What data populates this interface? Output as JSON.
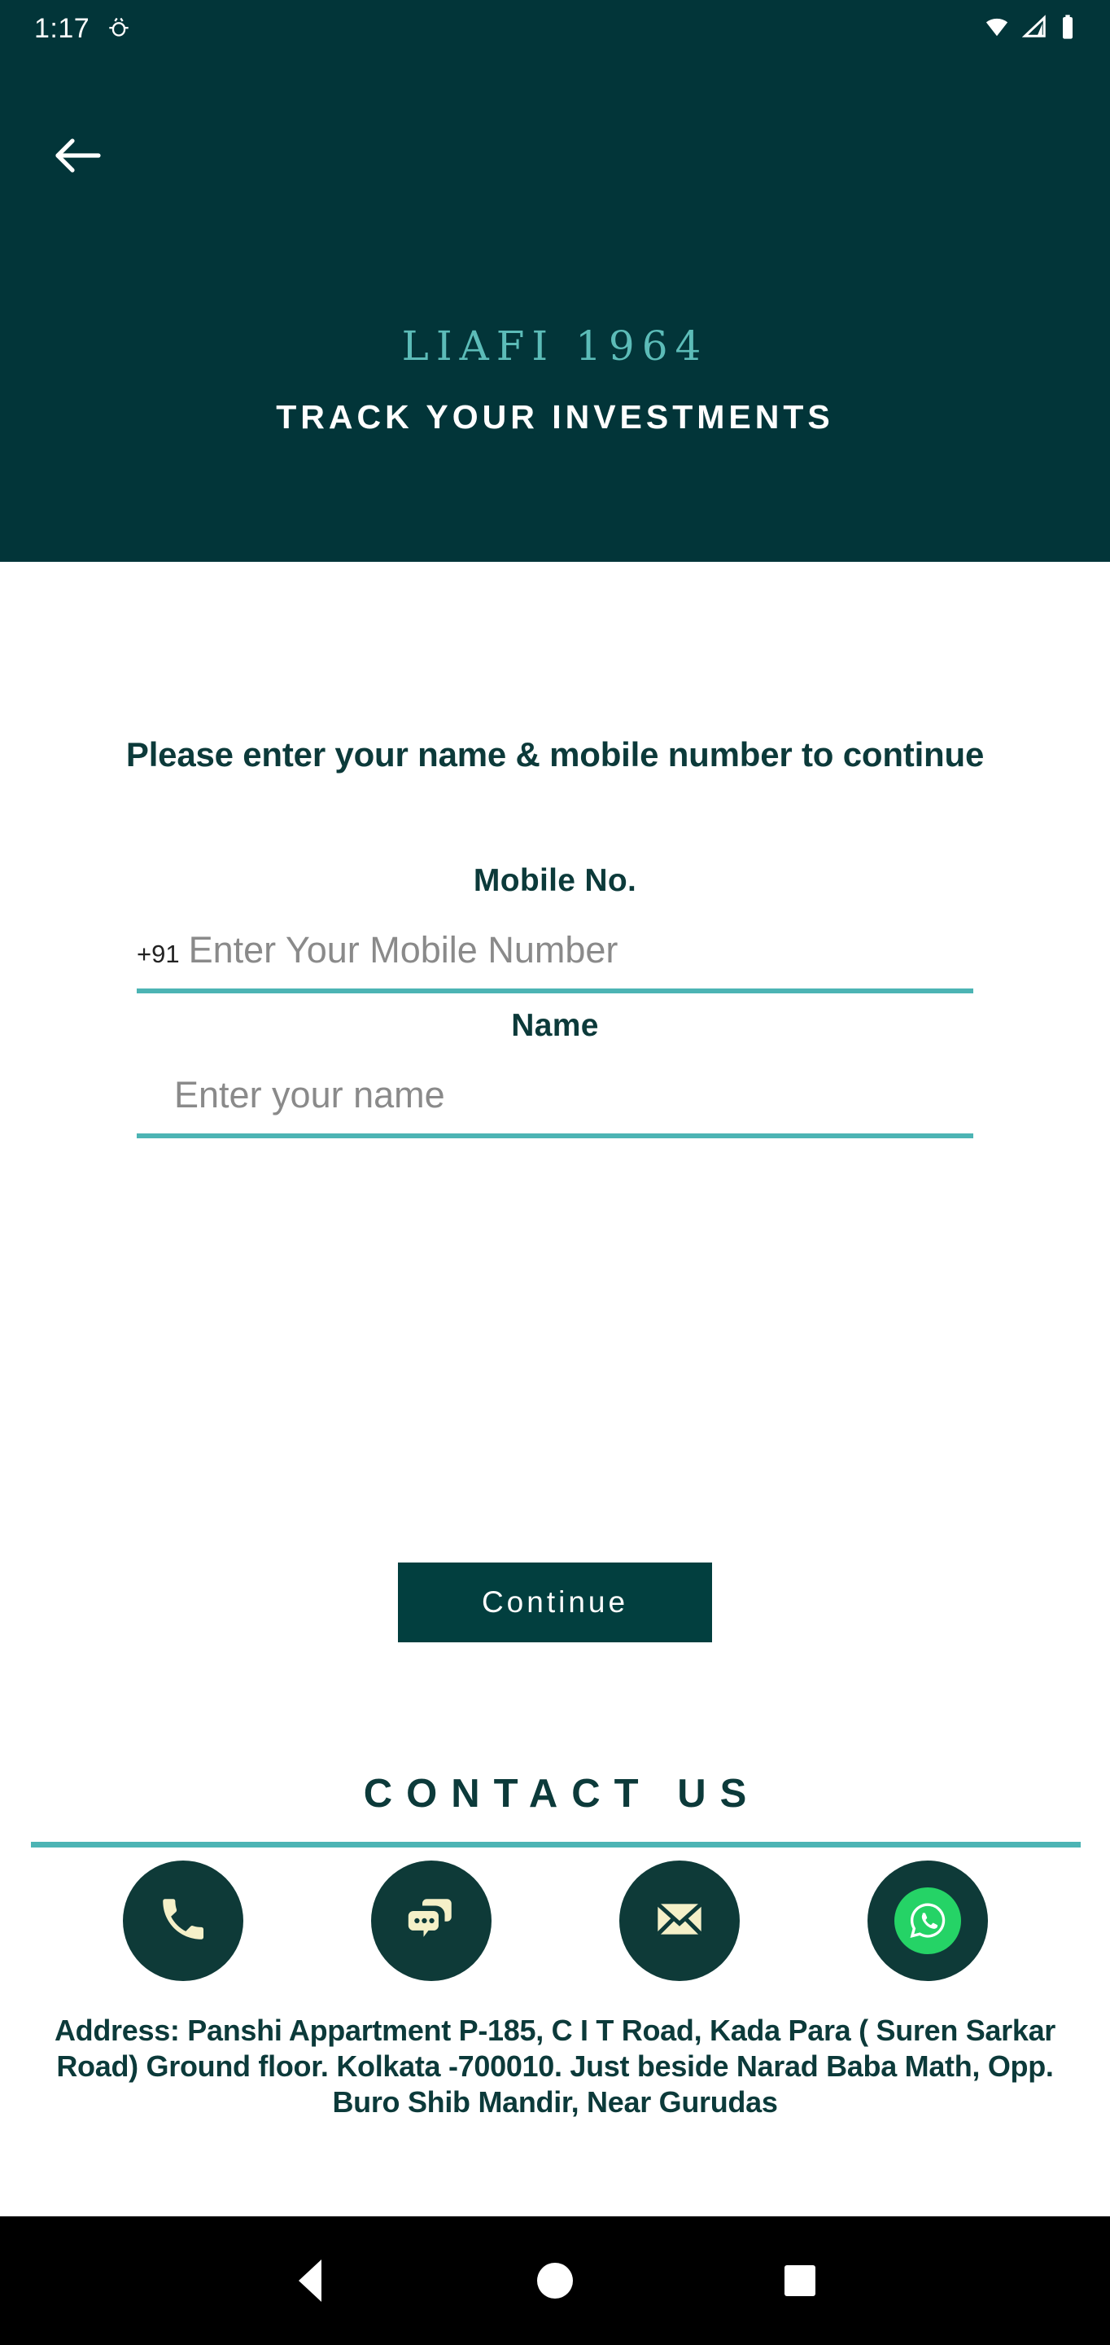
{
  "status_bar": {
    "time": "1:17",
    "icons": [
      "android-debug-icon",
      "wifi-icon",
      "cellular-signal-icon",
      "battery-icon"
    ]
  },
  "header": {
    "back_icon": "back-arrow-icon",
    "brand_title": "LIAFI 1964",
    "brand_subtitle": "TRACK YOUR INVESTMENTS",
    "bg_color": "#023539",
    "brand_color": "#5cbcb8"
  },
  "form": {
    "prompt": "Please enter your name & mobile number to continue",
    "mobile": {
      "label": "Mobile No.",
      "country_code": "+91",
      "placeholder": "Enter Your Mobile Number",
      "value": ""
    },
    "name": {
      "label": "Name",
      "placeholder": "Enter your name",
      "value": ""
    },
    "continue_label": "Continue",
    "underline_color": "#4cb4b4",
    "button_color": "#023f3f"
  },
  "contact": {
    "title": "CONTACT US",
    "items": [
      {
        "icon": "phone-icon",
        "name": "contact-phone"
      },
      {
        "icon": "chat-icon",
        "name": "contact-chat"
      },
      {
        "icon": "email-icon",
        "name": "contact-email"
      },
      {
        "icon": "whatsapp-icon",
        "name": "contact-whatsapp",
        "accent": "#25d366"
      }
    ],
    "address": "Address: Panshi Appartment P-185, C I T Road, Kada Para ( Suren Sarkar Road) Ground floor. Kolkata -700010. Just beside Narad Baba Math, Opp. Buro Shib Mandir, Near Gurudas"
  },
  "navbar": {
    "back": "nav-back-icon",
    "home": "nav-home-icon",
    "recents": "nav-recents-icon"
  }
}
